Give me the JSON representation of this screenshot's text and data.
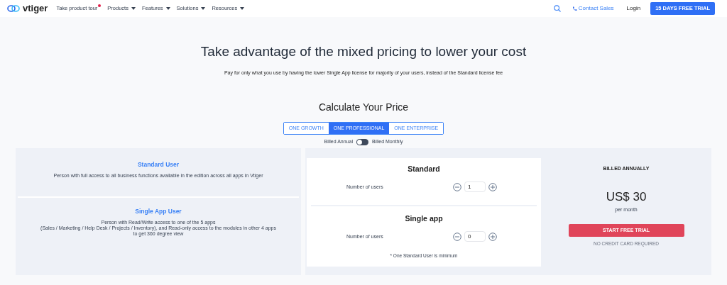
{
  "nav": {
    "logo": "vtiger",
    "items": [
      {
        "label": "Take product tour",
        "kind": "dot"
      },
      {
        "label": "Products",
        "kind": "menu"
      },
      {
        "label": "Features",
        "kind": "menu"
      },
      {
        "label": "Solutions",
        "kind": "menu"
      },
      {
        "label": "Resources",
        "kind": "menu"
      }
    ],
    "contact": "Contact Sales",
    "login": "Login",
    "trial": "15 DAYS FREE TRIAL"
  },
  "hero": {
    "title": "Take advantage of the mixed pricing to lower your cost",
    "subtitle": "Pay for only what you use by having the lower Single App license for majority of your users, instead of the Standard license fee"
  },
  "calculator": {
    "title": "Calculate Your Price",
    "editions": [
      {
        "label": "ONE GROWTH",
        "selected": false
      },
      {
        "label": "ONE PROFESSIONAL",
        "selected": true
      },
      {
        "label": "ONE ENTERPRISE",
        "selected": false
      }
    ],
    "billing": {
      "left": "Billed Annual",
      "right": "Billed Monthly",
      "on": false
    }
  },
  "user_types": [
    {
      "title": "Standard User",
      "description": [
        "Person with full access to all business functions available in the edition across all apps in Vtiger"
      ]
    },
    {
      "title": "Single App User",
      "description": [
        "Person with Read/Write access to one of the 5 apps",
        "(Sales / Marketing / Help Desk / Projects / Inventory), and Read-only access to the modules in other 4 apps",
        "to get 360 degree view"
      ]
    }
  ],
  "licenses": [
    {
      "title": "Standard",
      "label": "Number of users",
      "value": "1"
    },
    {
      "title": "Single app",
      "label": "Number of users",
      "value": "0"
    }
  ],
  "note": "* One Standard User is minimum",
  "summary": {
    "heading": "BILLED ANNUALLY",
    "price": "US$ 30",
    "period": "per month",
    "button": "START FREE TRIAL",
    "footnote": "NO CREDIT CARD REQUIRED"
  }
}
